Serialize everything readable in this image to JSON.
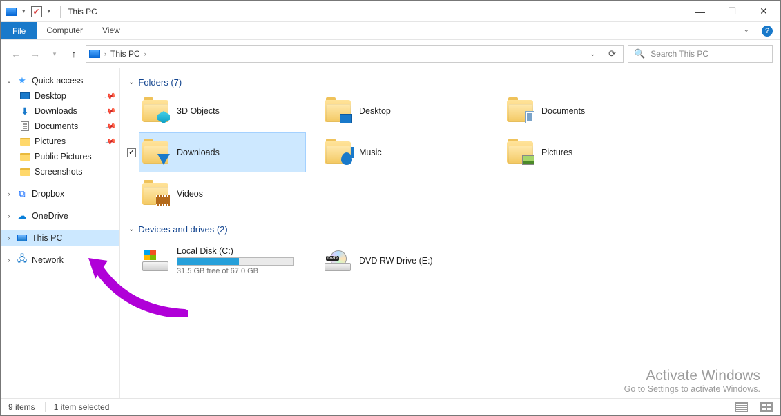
{
  "window": {
    "title": "This PC"
  },
  "ribbon": {
    "file": "File",
    "tabs": [
      "Computer",
      "View"
    ]
  },
  "nav": {
    "back_enabled": false,
    "forward_enabled": false,
    "breadcrumb": "This PC"
  },
  "search": {
    "placeholder": "Search This PC"
  },
  "sidebar": {
    "quick_access": {
      "label": "Quick access",
      "items": [
        {
          "label": "Desktop",
          "pinned": true
        },
        {
          "label": "Downloads",
          "pinned": true
        },
        {
          "label": "Documents",
          "pinned": true
        },
        {
          "label": "Pictures",
          "pinned": true
        },
        {
          "label": "Public Pictures",
          "pinned": false
        },
        {
          "label": "Screenshots",
          "pinned": false
        }
      ]
    },
    "dropbox": {
      "label": "Dropbox"
    },
    "onedrive": {
      "label": "OneDrive"
    },
    "this_pc": {
      "label": "This PC",
      "selected": true
    },
    "network": {
      "label": "Network"
    }
  },
  "sections": {
    "folders": {
      "header": "Folders (7)",
      "items": [
        {
          "label": "3D Objects"
        },
        {
          "label": "Desktop"
        },
        {
          "label": "Documents"
        },
        {
          "label": "Downloads",
          "selected": true
        },
        {
          "label": "Music"
        },
        {
          "label": "Pictures"
        },
        {
          "label": "Videos"
        }
      ]
    },
    "drives": {
      "header": "Devices and drives (2)",
      "items": [
        {
          "label": "Local Disk (C:)",
          "free_text": "31.5 GB free of 67.0 GB",
          "fill_pct": 53
        },
        {
          "label": "DVD RW Drive (E:)"
        }
      ]
    }
  },
  "statusbar": {
    "count": "9 items",
    "selection": "1 item selected"
  },
  "watermark": {
    "title": "Activate Windows",
    "sub": "Go to Settings to activate Windows."
  }
}
